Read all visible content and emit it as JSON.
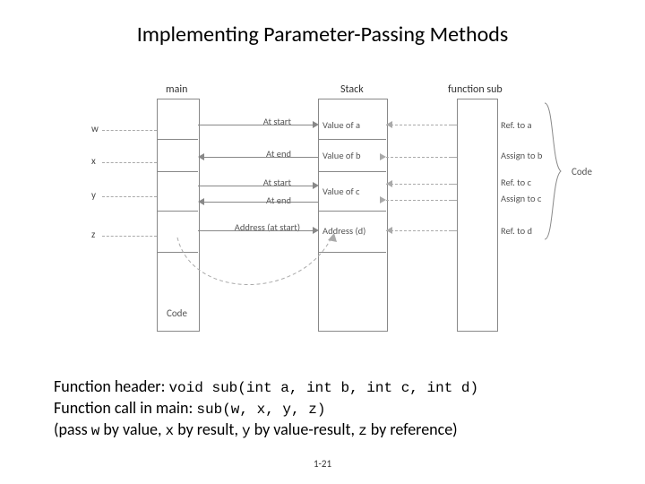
{
  "title": "Implementing Parameter-Passing Methods",
  "col": {
    "main": "main",
    "stack": "Stack",
    "sub": "function sub"
  },
  "vars": {
    "w": "w",
    "x": "x",
    "y": "y",
    "z": "z"
  },
  "rows": {
    "w_at_start": "At start",
    "x_at_end": "At end",
    "y_at_start": "At start",
    "y_at_end": "At end",
    "z_addr": "Address (at start)"
  },
  "stack": {
    "a": "Value of a",
    "b": "Value of b",
    "c": "Value of c",
    "d": "Address (d)"
  },
  "sub": {
    "a": "Ref. to a",
    "b": "Assign to b",
    "c1": "Ref. to c",
    "c2": "Assign to c",
    "d": "Ref. to d"
  },
  "code_main": "Code",
  "code_brace": "Code",
  "bottom": {
    "l1a": "Function header: ",
    "l1b": "void sub(int a, int b, int c, int d)",
    "l2a": "Function call in main: ",
    "l2b": "sub(w, x, y, z)",
    "l3a": "(pass ",
    "l3b": "w",
    "l3c": " by value, ",
    "l3d": "x",
    "l3e": " by result, ",
    "l3f": "y",
    "l3g": " by value-result, ",
    "l3h": "z",
    "l3i": " by reference)"
  },
  "footer": "1-21"
}
